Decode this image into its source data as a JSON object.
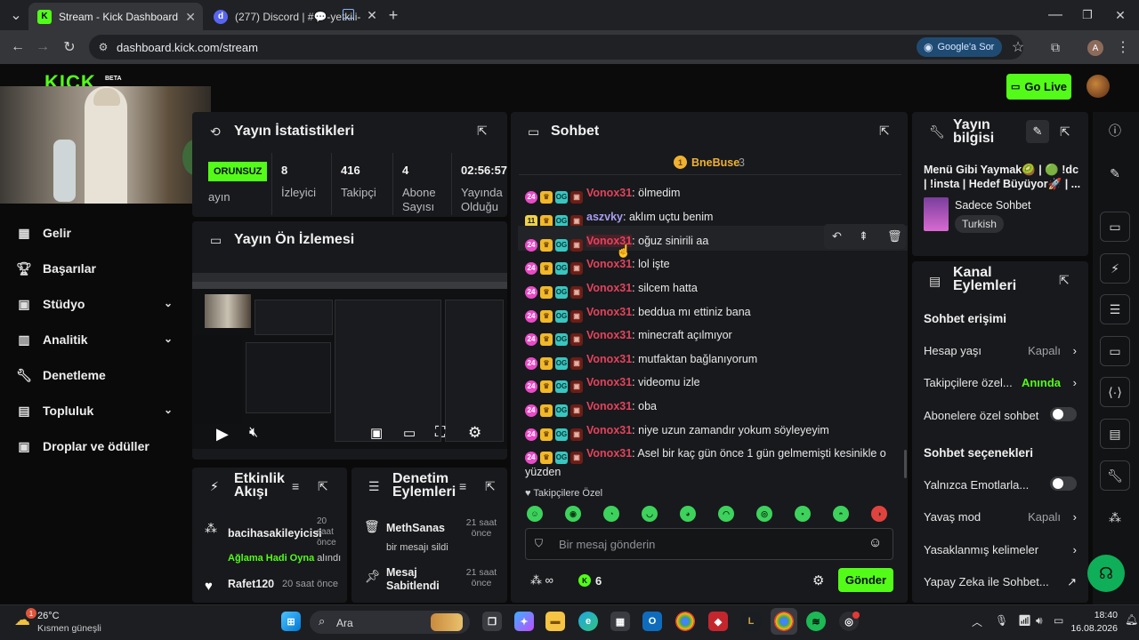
{
  "browser": {
    "tabs": [
      {
        "title": "Stream - Kick Dashboard",
        "active": true
      },
      {
        "title": "(277) Discord | #💬-yetkili-",
        "badge": "277",
        "active": false
      }
    ],
    "url": "dashboard.kick.com/stream",
    "google_search_label": "Google'a Sor",
    "profile_letter": "A"
  },
  "header": {
    "logo": "KICK",
    "beta": "BETA",
    "go_live_label": "Go Live"
  },
  "nav": {
    "items": [
      {
        "label": "Gelir",
        "icon": "table-icon",
        "chevron": false
      },
      {
        "label": "Başarılar",
        "icon": "trophy-icon",
        "chevron": false
      },
      {
        "label": "Stüdyo",
        "icon": "studio-icon",
        "chevron": true
      },
      {
        "label": "Analitik",
        "icon": "chart-icon",
        "chevron": true
      },
      {
        "label": "Denetleme",
        "icon": "wrench-icon",
        "chevron": false
      },
      {
        "label": "Topluluk",
        "icon": "community-icon",
        "chevron": true
      },
      {
        "label": "Droplar ve ödüller",
        "icon": "drops-icon",
        "chevron": false
      }
    ]
  },
  "stats": {
    "title": "Yayın İstatistikleri",
    "offline_badge": "ORUNSUZ",
    "offline_sub": "ayın",
    "items": [
      {
        "value": "8",
        "label": "İzleyici"
      },
      {
        "value": "416",
        "label": "Takipçi"
      },
      {
        "value": "4",
        "label": "Abone Sayısı"
      },
      {
        "value": "02:56:57",
        "label": "Yayında Olduğu"
      }
    ]
  },
  "preview": {
    "title": "Yayın Ön İzlemesi"
  },
  "activity": {
    "title": "Etkinlik Akışı",
    "items": [
      {
        "user": "bacihasakileyicisi",
        "time": "20 saat önce",
        "detail_highlight": "Ağlama Hadi Oyna",
        "detail_rest": " alındı"
      },
      {
        "user": "Rafet120",
        "time": "20 saat önce"
      }
    ]
  },
  "moderation": {
    "title": "Denetim Eylemleri",
    "items": [
      {
        "user": "MethSanas",
        "action": "bir mesajı sildi",
        "time": "21 saat önce"
      },
      {
        "user": "Mesaj Sabitlendi",
        "time": "21 saat önce"
      }
    ]
  },
  "chat": {
    "title": "Sohbet",
    "pinned_user": "BneBuse",
    "pinned_count": "3",
    "messages": [
      {
        "user": "Vonox31",
        "color": "#e2435c",
        "sub": "24",
        "text": ": ölmedim"
      },
      {
        "user": "aszvky",
        "color": "#a99cf2",
        "sub": "11",
        "text": ": aklım uçtu benim"
      },
      {
        "user": "Vonox31",
        "color": "#e2435c",
        "sub": "24",
        "text": ": oğuz sinirili aa"
      },
      {
        "user": "Vonox31",
        "color": "#e2435c",
        "sub": "24",
        "text": ": lol işte"
      },
      {
        "user": "Vonox31",
        "color": "#e2435c",
        "sub": "24",
        "text": ": silcem hatta"
      },
      {
        "user": "Vonox31",
        "color": "#e2435c",
        "sub": "24",
        "text": ": beddua mı ettiniz bana"
      },
      {
        "user": "Vonox31",
        "color": "#e2435c",
        "sub": "24",
        "text": ": minecraft açılmıyor"
      },
      {
        "user": "Vonox31",
        "color": "#e2435c",
        "sub": "24",
        "text": ": mutfaktan bağlanıyorum"
      },
      {
        "user": "Vonox31",
        "color": "#e2435c",
        "sub": "24",
        "text": ": videomu izle"
      },
      {
        "user": "Vonox31",
        "color": "#e2435c",
        "sub": "24",
        "text": ": oba"
      },
      {
        "user": "Vonox31",
        "color": "#e2435c",
        "sub": "24",
        "text": ": niye uzun zamandır yokum söyleyeyim"
      },
      {
        "user": "Vonox31",
        "color": "#e2435c",
        "sub": "24",
        "text": ": Asel bir kaç gün önce 1 gün gelmemişti kesinikle o yüzden"
      }
    ],
    "followers_only_label": "Takipçilere Özel",
    "input_placeholder": "Bir mesaj gönderin",
    "points_count": "6",
    "send_label": "Gönder"
  },
  "stream_info": {
    "title": "Yayın bilgisi",
    "stream_title": "Menü Gibi Yaymak🥝 | 🟢 !dc | !insta | Hedef Büyüyor🚀 | ...",
    "category": "Sadece Sohbet",
    "language": "Turkish"
  },
  "channel_actions": {
    "title": "Kanal Eylemleri",
    "chat_access_heading": "Sohbet erişimi",
    "rows1": [
      {
        "label": "Hesap yaşı",
        "value": "Kapalı",
        "kind": "chevron"
      },
      {
        "label": "Takipçilere özel...",
        "value": "Anında",
        "kind": "chevron-green"
      },
      {
        "label": "Abonelere özel sohbet",
        "kind": "toggle"
      }
    ],
    "chat_options_heading": "Sohbet seçenekleri",
    "rows2": [
      {
        "label": "Yalnızca Emotlarla...",
        "kind": "toggle"
      },
      {
        "label": "Yavaş mod",
        "value": "Kapalı",
        "kind": "chevron"
      },
      {
        "label": "Yasaklanmış kelimeler",
        "kind": "chevron"
      },
      {
        "label": "Yapay Zeka ile Sohbet...",
        "kind": "external"
      }
    ]
  },
  "taskbar": {
    "weather_temp": "26°C",
    "weather_desc": "Kısmen güneşli",
    "search_placeholder": "Ara",
    "time": "18:40",
    "date": "16.08.2026"
  },
  "colors": {
    "kick_green": "#53fc18",
    "panel_bg": "#18191c",
    "page_bg": "#0a0a0a"
  }
}
